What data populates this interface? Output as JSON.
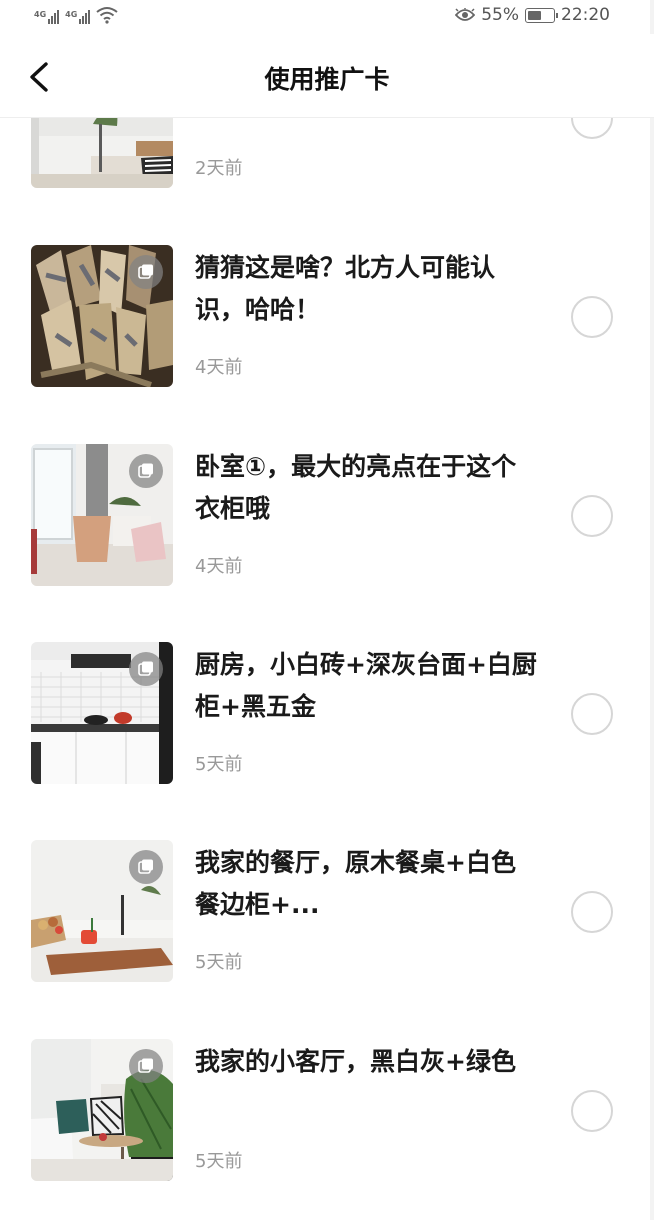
{
  "status_bar": {
    "network_1": "4G",
    "network_2": "4G",
    "battery_percent": "55%",
    "battery_level": 0.55,
    "time": "22:20"
  },
  "nav": {
    "title": "使用推广卡",
    "back_icon": "chevron-left-icon"
  },
  "items": [
    {
      "title": "",
      "time": "2天前",
      "selected": false,
      "multi_image": false
    },
    {
      "title": "猜猜这是啥？北方人可能认识，哈哈！",
      "time": "4天前",
      "selected": false,
      "multi_image": true
    },
    {
      "title": "卧室①，最大的亮点在于这个衣柜哦",
      "time": "4天前",
      "selected": false,
      "multi_image": true
    },
    {
      "title": "厨房，小白砖+深灰台面+白厨柜+黑五金",
      "time": "5天前",
      "selected": false,
      "multi_image": true
    },
    {
      "title": "我家的餐厅，原木餐桌+白色餐边柜+...",
      "time": "5天前",
      "selected": false,
      "multi_image": true
    },
    {
      "title": "我家的小客厅，黑白灰+绿色",
      "time": "5天前",
      "selected": false,
      "multi_image": true
    }
  ],
  "icons": {
    "multi_image": "multi-image-icon",
    "radio": "radio-unchecked-icon"
  }
}
